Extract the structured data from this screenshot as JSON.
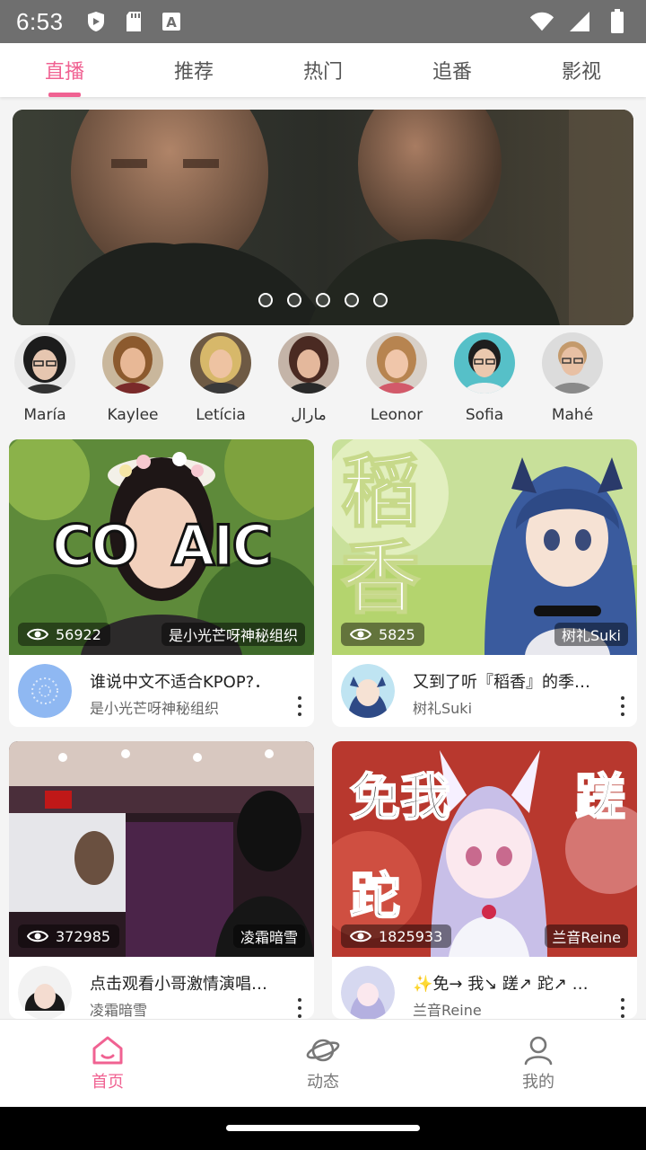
{
  "status_bar": {
    "time": "6:53",
    "left_icons": [
      "shield-icon",
      "sd-card-icon",
      "font-icon"
    ],
    "right_icons": [
      "wifi-icon",
      "signal-icon",
      "battery-icon"
    ]
  },
  "top_tabs": [
    {
      "label": "直播",
      "active": true
    },
    {
      "label": "推荐",
      "active": false
    },
    {
      "label": "热门",
      "active": false
    },
    {
      "label": "追番",
      "active": false
    },
    {
      "label": "影视",
      "active": false
    }
  ],
  "banner": {
    "slide_count": 5,
    "active_slide": 1
  },
  "streamers": [
    {
      "name": "María"
    },
    {
      "name": "Kaylee"
    },
    {
      "name": "Letícia"
    },
    {
      "name": "مارال"
    },
    {
      "name": "Leonor"
    },
    {
      "name": "Sofia"
    },
    {
      "name": "Mahé"
    }
  ],
  "cards": [
    {
      "views": "56922",
      "pill_author": "是小光芒呀神秘组织",
      "title": "谁说中文不适合KPOP?．",
      "author": "是小光芒呀神秘组织",
      "thumb_text": "CO  AIC"
    },
    {
      "views": "5825",
      "pill_author": "树礼Suki",
      "title": "又到了听『稻香』的季…",
      "author": "树礼Suki",
      "thumb_text": "稻香"
    },
    {
      "views": "372985",
      "pill_author": "凌霜暗雪",
      "title": "点击观看小哥激情演唱…",
      "author": "凌霜暗雪",
      "thumb_text": ""
    },
    {
      "views": "1825933",
      "pill_author": "兰音Reine",
      "title": "✨免→ 我↘ 蹉↗ 跎↗ …",
      "author": "兰音Reine",
      "thumb_text": "免我 蹉跎"
    }
  ],
  "bottom_nav": [
    {
      "label": "首页",
      "icon": "home-icon",
      "active": true
    },
    {
      "label": "动态",
      "icon": "planet-icon",
      "active": false
    },
    {
      "label": "我的",
      "icon": "profile-icon",
      "active": false
    }
  ],
  "colors": {
    "accent": "#f06292",
    "status_bar": "#6f6f6f"
  }
}
